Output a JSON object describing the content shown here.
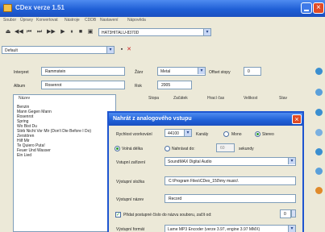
{
  "window": {
    "title": "CDex verze 1.51"
  },
  "menu": [
    "Soubor",
    "Úpravy",
    "Konvertovat",
    "Nástroje",
    "CDDB",
    "Nastavení",
    "Nápověda"
  ],
  "toolbar": {
    "drive": "HAT3HITALU-8370D",
    "profile": "Default"
  },
  "info": {
    "interpret_label": "Interpret",
    "interpret": "Rammstein",
    "album_label": "Album",
    "album": "Rosenrot",
    "genre_label": "Žánr",
    "genre": "Metal",
    "offset_label": "Offset stopy",
    "offset": "0",
    "year_label": "Rok",
    "year": "2005"
  },
  "list": {
    "columns": [
      "Název",
      "Stopa",
      "Začátek",
      "Hrací čas",
      "Velikost",
      "Stav"
    ],
    "tracks": [
      "Benzin",
      "Mann Gegen Mann",
      "Rosenrot",
      "Spring",
      "Wo Bist Du",
      "Stirb Nicht Vor Mir (Don't Die Before I Do)",
      "Zerstören",
      "Hilf Mir",
      "Te Quiero Puta!",
      "Feuer Und Wasser",
      "Ein Lied"
    ]
  },
  "dialog": {
    "title": "Nahrát z analogového vstupu",
    "rate_label": "Rychlost vzorkování",
    "rate": "44100",
    "channels_label": "Kanály",
    "mono": "Mono",
    "stereo": "Stereo",
    "length_any": "Volná délka",
    "length_fixed": "Nahrávat do:",
    "length_value": "60",
    "length_unit": "sekundy",
    "input_device_label": "Vstupní zařízení",
    "input_device": "SoundMAX Digital Audio",
    "output_folder_label": "Výstupní složka",
    "output_folder": "C:\\Program Files\\CDex_150\\my music\\",
    "output_name_label": "Výstupní název",
    "output_name": "Record",
    "append_label": "Přidat postupné číslo do názvu souboru, začít od:",
    "append_value": "0",
    "encoder_label": "Výstupní formát",
    "encoder": "Lame MP3 Encoder (verze 3.97, engine 3.97 MMX)"
  }
}
